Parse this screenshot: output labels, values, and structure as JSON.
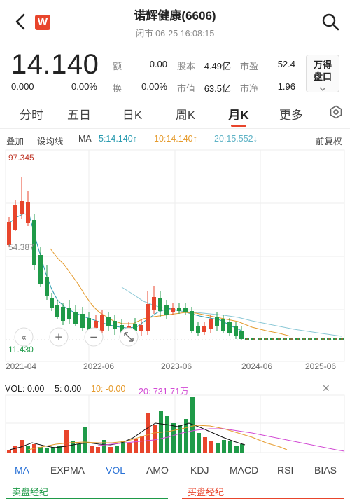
{
  "header": {
    "logo_letter": "W",
    "title": "诺辉健康(6606)",
    "status": "闭市 06-25 16:08:15"
  },
  "quote": {
    "price": "14.140",
    "change": "0.000",
    "change_pct": "0.00%",
    "amount_label": "额",
    "amount_value": "0.00",
    "turnover_label": "换",
    "turnover_value": "0.00%",
    "shares_label": "股本",
    "shares_value": "4.49亿",
    "mktcap_label": "市值",
    "mktcap_value": "63.5亿",
    "pe_label": "市盈",
    "pe_value": "52.4",
    "pb_label": "市净",
    "pb_value": "1.96",
    "wande_line1": "万得",
    "wande_line2": "盘口"
  },
  "tabs": [
    "分时",
    "五日",
    "日K",
    "周K",
    "月K",
    "更多"
  ],
  "active_tab": "月K",
  "indicators": {
    "overlay": "叠加",
    "draw": "设均线",
    "ma_label": "MA",
    "ma5": "5:14.140↑",
    "ma10": "10:14.140↑",
    "ma20": "20:15.552↓",
    "adjust": "前复权"
  },
  "chart": {
    "high_label": "97.345",
    "mid_label": "54.387",
    "low_label": "11.430",
    "x_ticks": [
      "2021-04",
      "2022-06",
      "2023-06",
      "2024-06",
      "2025-06"
    ]
  },
  "volume": {
    "label": "VOL: 0.00",
    "ma5": "5: 0.00",
    "ma10": "10: -0.00",
    "ma20": "20: 731.71万"
  },
  "bottom_tabs": [
    "MA",
    "EXPMA",
    "VOL",
    "AMO",
    "KDJ",
    "MACD",
    "RSI",
    "BIAS"
  ],
  "active_bottom_tabs": [
    "MA",
    "VOL"
  ],
  "sell_broker": "卖盘经纪",
  "buy_broker": "买盘经纪",
  "colors": {
    "up": "#e8452c",
    "down": "#1f9a48",
    "ma5": "#2a9bb0",
    "ma10": "#e59a2b",
    "ma20": "#8bc8d6",
    "vol_ma20": "#d24ad4",
    "accent": "#2a72d6"
  },
  "chart_data": {
    "type": "candlestick",
    "price_range": [
      11.43,
      97.345
    ],
    "x_ticks": [
      "2021-04",
      "2022-06",
      "2023-06",
      "2024-06",
      "2025-06"
    ]
  }
}
